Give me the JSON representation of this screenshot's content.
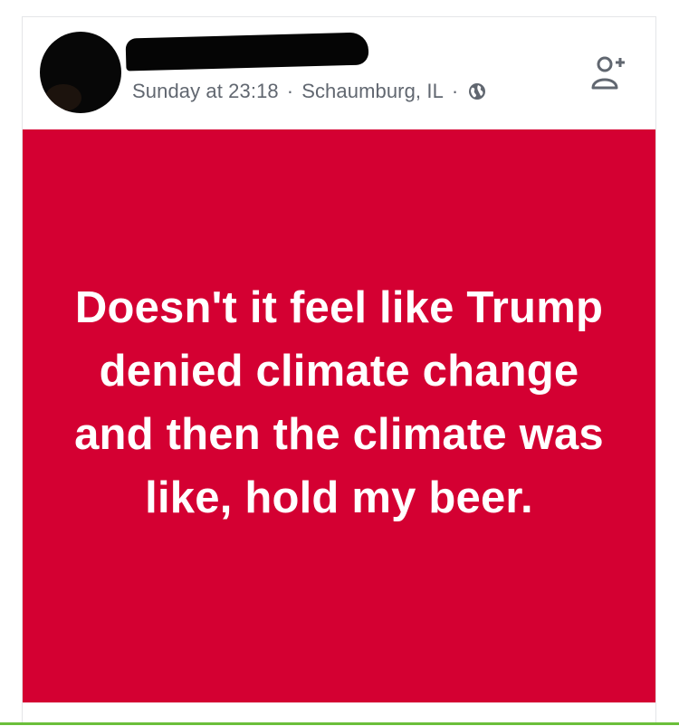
{
  "post": {
    "timestamp": "Sunday at 23:18",
    "separator": "·",
    "location": "Schaumburg, IL",
    "privacy_icon": "globe-icon",
    "add_friend_icon": "add-friend-icon",
    "text": "Doesn't it feel like Trump denied climate change and then the climate was like, hold my beer.",
    "background_color": "#d40032",
    "text_color": "#ffffff"
  },
  "colors": {
    "meta_text": "#616770",
    "card_border": "#e4e5e8"
  }
}
